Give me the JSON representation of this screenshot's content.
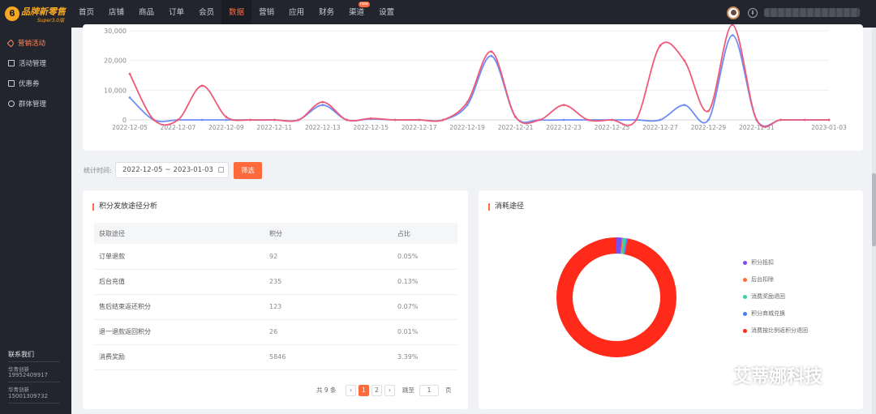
{
  "app": {
    "logo_text": "品牌新零售",
    "logo_sub": "Super3.0版",
    "brand_color": "#ff6a3d"
  },
  "nav": {
    "items": [
      {
        "label": "首页"
      },
      {
        "label": "店铺"
      },
      {
        "label": "商品"
      },
      {
        "label": "订单"
      },
      {
        "label": "会员"
      },
      {
        "label": "数据",
        "active": true
      },
      {
        "label": "营销"
      },
      {
        "label": "应用"
      },
      {
        "label": "财务"
      },
      {
        "label": "渠道",
        "badge": "new"
      },
      {
        "label": "设置"
      }
    ]
  },
  "sidebar": {
    "items": [
      {
        "label": "营销活动",
        "icon": "tag-icon",
        "active": true
      },
      {
        "label": "活动管理",
        "icon": "calendar-icon"
      },
      {
        "label": "优惠券",
        "icon": "coupon-icon"
      },
      {
        "label": "群体管理",
        "icon": "group-icon"
      }
    ],
    "contact": {
      "title": "联系我们",
      "entries": [
        {
          "name": "华青创新",
          "phone": "19952409917"
        },
        {
          "name": "华青创新",
          "phone": "15001309732"
        }
      ]
    }
  },
  "filter": {
    "label": "统计时间:",
    "start": "2022-12-05",
    "separator": "~",
    "end": "2023-01-03",
    "button": "筛选"
  },
  "chart_data": {
    "type": "line",
    "x": [
      "2022-12-05",
      "2022-12-06",
      "2022-12-07",
      "2022-12-08",
      "2022-12-09",
      "2022-12-10",
      "2022-12-11",
      "2022-12-12",
      "2022-12-13",
      "2022-12-14",
      "2022-12-15",
      "2022-12-16",
      "2022-12-17",
      "2022-12-18",
      "2022-12-19",
      "2022-12-20",
      "2022-12-21",
      "2022-12-22",
      "2022-12-23",
      "2022-12-24",
      "2022-12-25",
      "2022-12-26",
      "2022-12-27",
      "2022-12-28",
      "2022-12-29",
      "2022-12-30",
      "2022-12-31",
      "2023-01-01",
      "2023-01-02",
      "2023-01-03"
    ],
    "tick_labels": [
      "2022-12-05",
      "2022-12-07",
      "2022-12-09",
      "2022-12-11",
      "2022-12-13",
      "2022-12-15",
      "2022-12-17",
      "2022-12-19",
      "2022-12-21",
      "2022-12-23",
      "2022-12-25",
      "2022-12-27",
      "2022-12-29",
      "2022-12-31",
      "2023-01-03"
    ],
    "y_ticks": [
      "0",
      "10,000",
      "20,000",
      "30,000"
    ],
    "ylim": [
      0,
      30000
    ],
    "grid": true,
    "series": [
      {
        "color": "#ee5a78",
        "values": [
          15500,
          0,
          0,
          11500,
          1000,
          0,
          0,
          0,
          6000,
          0,
          500,
          0,
          0,
          0,
          6000,
          23000,
          1000,
          0,
          5000,
          0,
          0,
          0,
          25000,
          20000,
          3000,
          32000,
          0,
          0,
          0,
          0
        ]
      },
      {
        "color": "#6e8ef7",
        "values": [
          7500,
          0,
          0,
          0,
          0,
          0,
          0,
          0,
          5000,
          0,
          300,
          0,
          0,
          0,
          5000,
          21500,
          1000,
          0,
          0,
          0,
          0,
          0,
          0,
          5000,
          0,
          28500,
          0,
          0,
          0,
          0
        ]
      }
    ]
  },
  "points_table": {
    "title": "积分发放途径分析",
    "columns": [
      "获取途径",
      "积分",
      "占比"
    ],
    "rows": [
      [
        "订单退款",
        "92",
        "0.05%"
      ],
      [
        "后台充值",
        "235",
        "0.13%"
      ],
      [
        "售后结束返还积分",
        "123",
        "0.07%"
      ],
      [
        "退一退款返回积分",
        "26",
        "0.01%"
      ],
      [
        "消费奖励",
        "5846",
        "3.39%"
      ]
    ],
    "pagination": {
      "total": "共 9 条",
      "prev": "‹",
      "pages": [
        "1",
        "2"
      ],
      "current": "1",
      "next": "›",
      "jump_label": "跳至",
      "jump_value": "1",
      "page_unit": "页"
    }
  },
  "consume": {
    "title": "消耗途径",
    "chart_data": {
      "type": "pie",
      "labels": [
        "积分抵扣",
        "后台扣除",
        "消费奖励退回",
        "积分商城兑换",
        "消费按比例返积分退回"
      ],
      "values": [
        1.5,
        0.3,
        0.8,
        0.4,
        97.0
      ],
      "colors": [
        "#7b4cf0",
        "#ff6a3d",
        "#3ecf9a",
        "#4e7cf6",
        "#ff2a1a"
      ]
    }
  },
  "watermark": {
    "text": "艾蒂娜科技"
  }
}
